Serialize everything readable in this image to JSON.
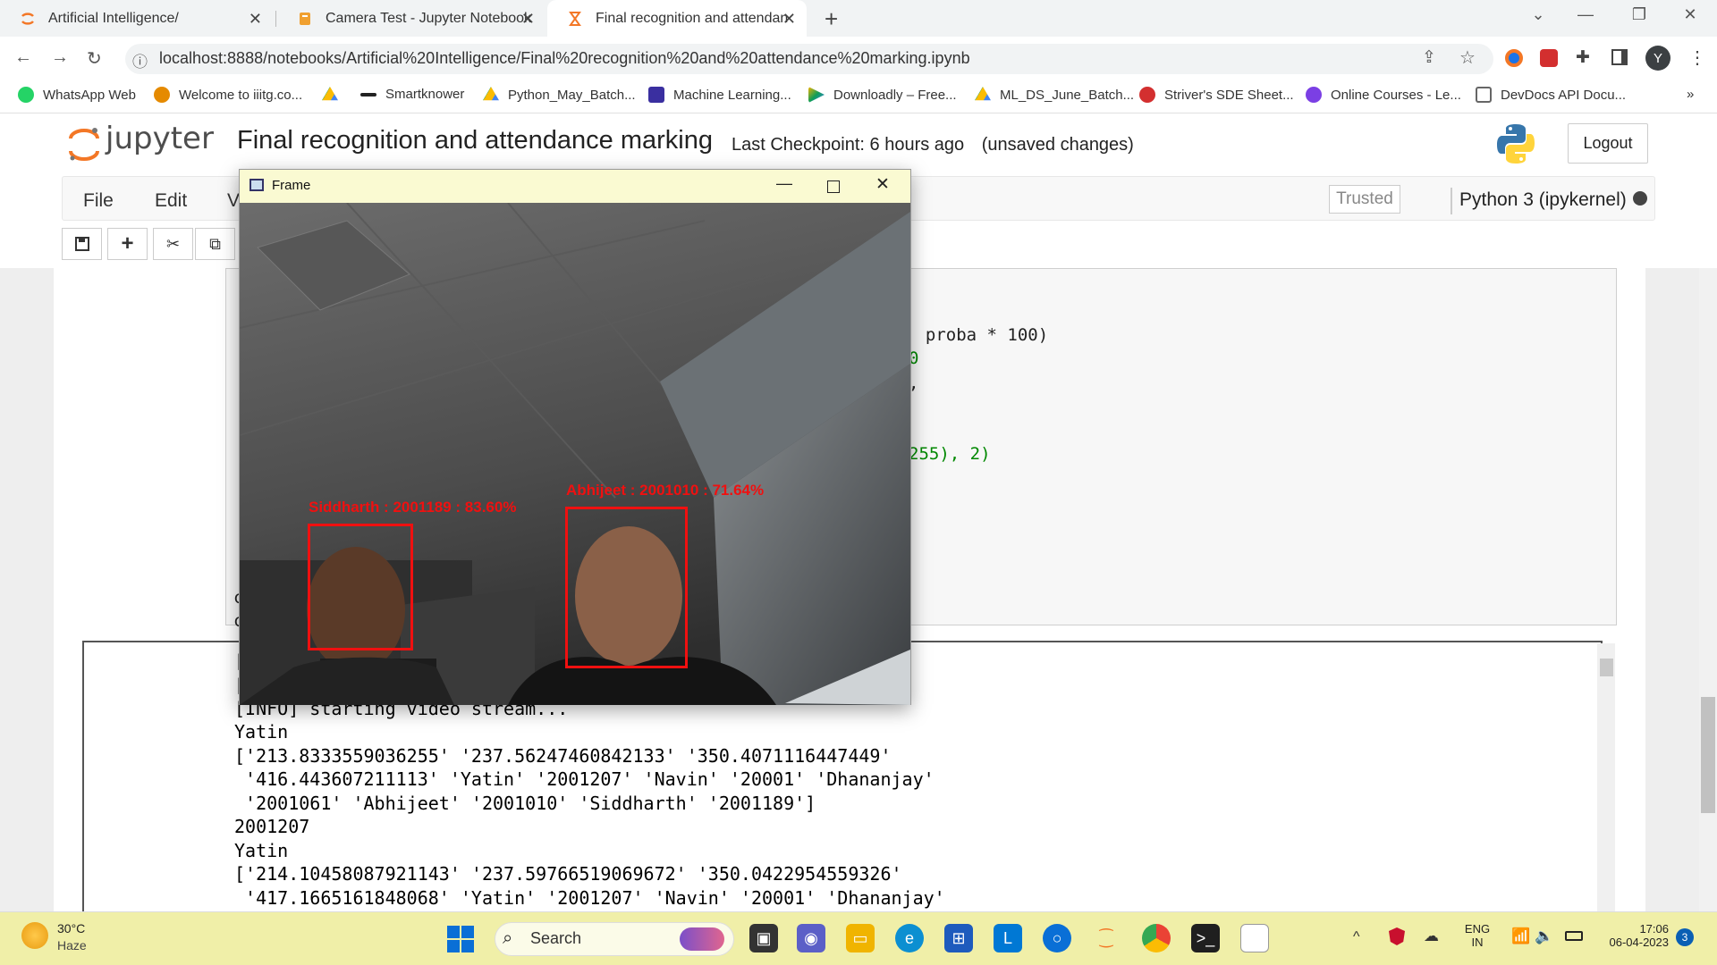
{
  "browser": {
    "tabs": [
      {
        "title": "Artificial Intelligence/",
        "close": "✕"
      },
      {
        "title": "Camera Test - Jupyter Notebook",
        "close": "✕"
      },
      {
        "title": "Final recognition and attendance",
        "close": "✕"
      }
    ],
    "new_tab": "+",
    "url": "localhost:8888/notebooks/Artificial%20Intelligence/Final%20recognition%20and%20attendance%20marking.ipynb",
    "profile_initial": "Y",
    "bookmarks": [
      {
        "label": "WhatsApp Web",
        "color": "#25d366"
      },
      {
        "label": "Welcome to iiitg.co...",
        "color": "#e58a00"
      },
      {
        "label": "",
        "color": "#34a853"
      },
      {
        "label": "Smartknower",
        "color": "#222222"
      },
      {
        "label": "Python_May_Batch...",
        "color": "#4285f4"
      },
      {
        "label": "Machine Learning...",
        "color": "#3a2fa0"
      },
      {
        "label": "Downloadly – Free...",
        "color": "#f4b400"
      },
      {
        "label": "ML_DS_June_Batch...",
        "color": "#34a853"
      },
      {
        "label": "Striver's SDE Sheet...",
        "color": "#d32f2f"
      },
      {
        "label": "Online Courses - Le...",
        "color": "#7b3fe4"
      },
      {
        "label": "DevDocs API Docu...",
        "color": "#666666"
      }
    ],
    "more": "»"
  },
  "jupyter": {
    "logo": "jupyter",
    "notebook_title": "Final recognition and attendance marking",
    "checkpoint": "Last Checkpoint: 6 hours ago",
    "unsaved": "(unsaved changes)",
    "logout": "Logout",
    "menu": [
      "File",
      "Edit",
      "V"
    ],
    "trusted": "Trusted",
    "kernel": "Python 3 (ipykernel)"
  },
  "code_visible": [
    ", proba * 100)",
    "0",
    ",",
    "255), 2)"
  ],
  "output_lines": [
    "[INFO] starting video stream...",
    "Yatin",
    "['213.8333559036255' '237.56247460842133' '350.4071116447449'",
    " '416.443607211113' 'Yatin' '2001207' 'Navin' '20001' 'Dhananjay'",
    " '2001061' 'Abhijeet' '2001010' 'Siddharth' '2001189']",
    "2001207",
    "Yatin",
    "['214.10458087921143' '237.59766519069672' '350.0422954559326'",
    " '417.1665161848068' 'Yatin' '2001207' 'Navin' '20001' 'Dhananjay'"
  ],
  "frame_window": {
    "title": "Frame",
    "detections": [
      {
        "label": "Siddharth : 2001189 : 83.60%"
      },
      {
        "label": "Abhijeet : 2001010 : 71.64%"
      }
    ]
  },
  "taskbar": {
    "temperature": "30°C",
    "weather": "Haze",
    "search": "Search",
    "language": "ENG",
    "region": "IN",
    "time": "17:06",
    "date": "06-04-2023",
    "notifications": "3"
  }
}
